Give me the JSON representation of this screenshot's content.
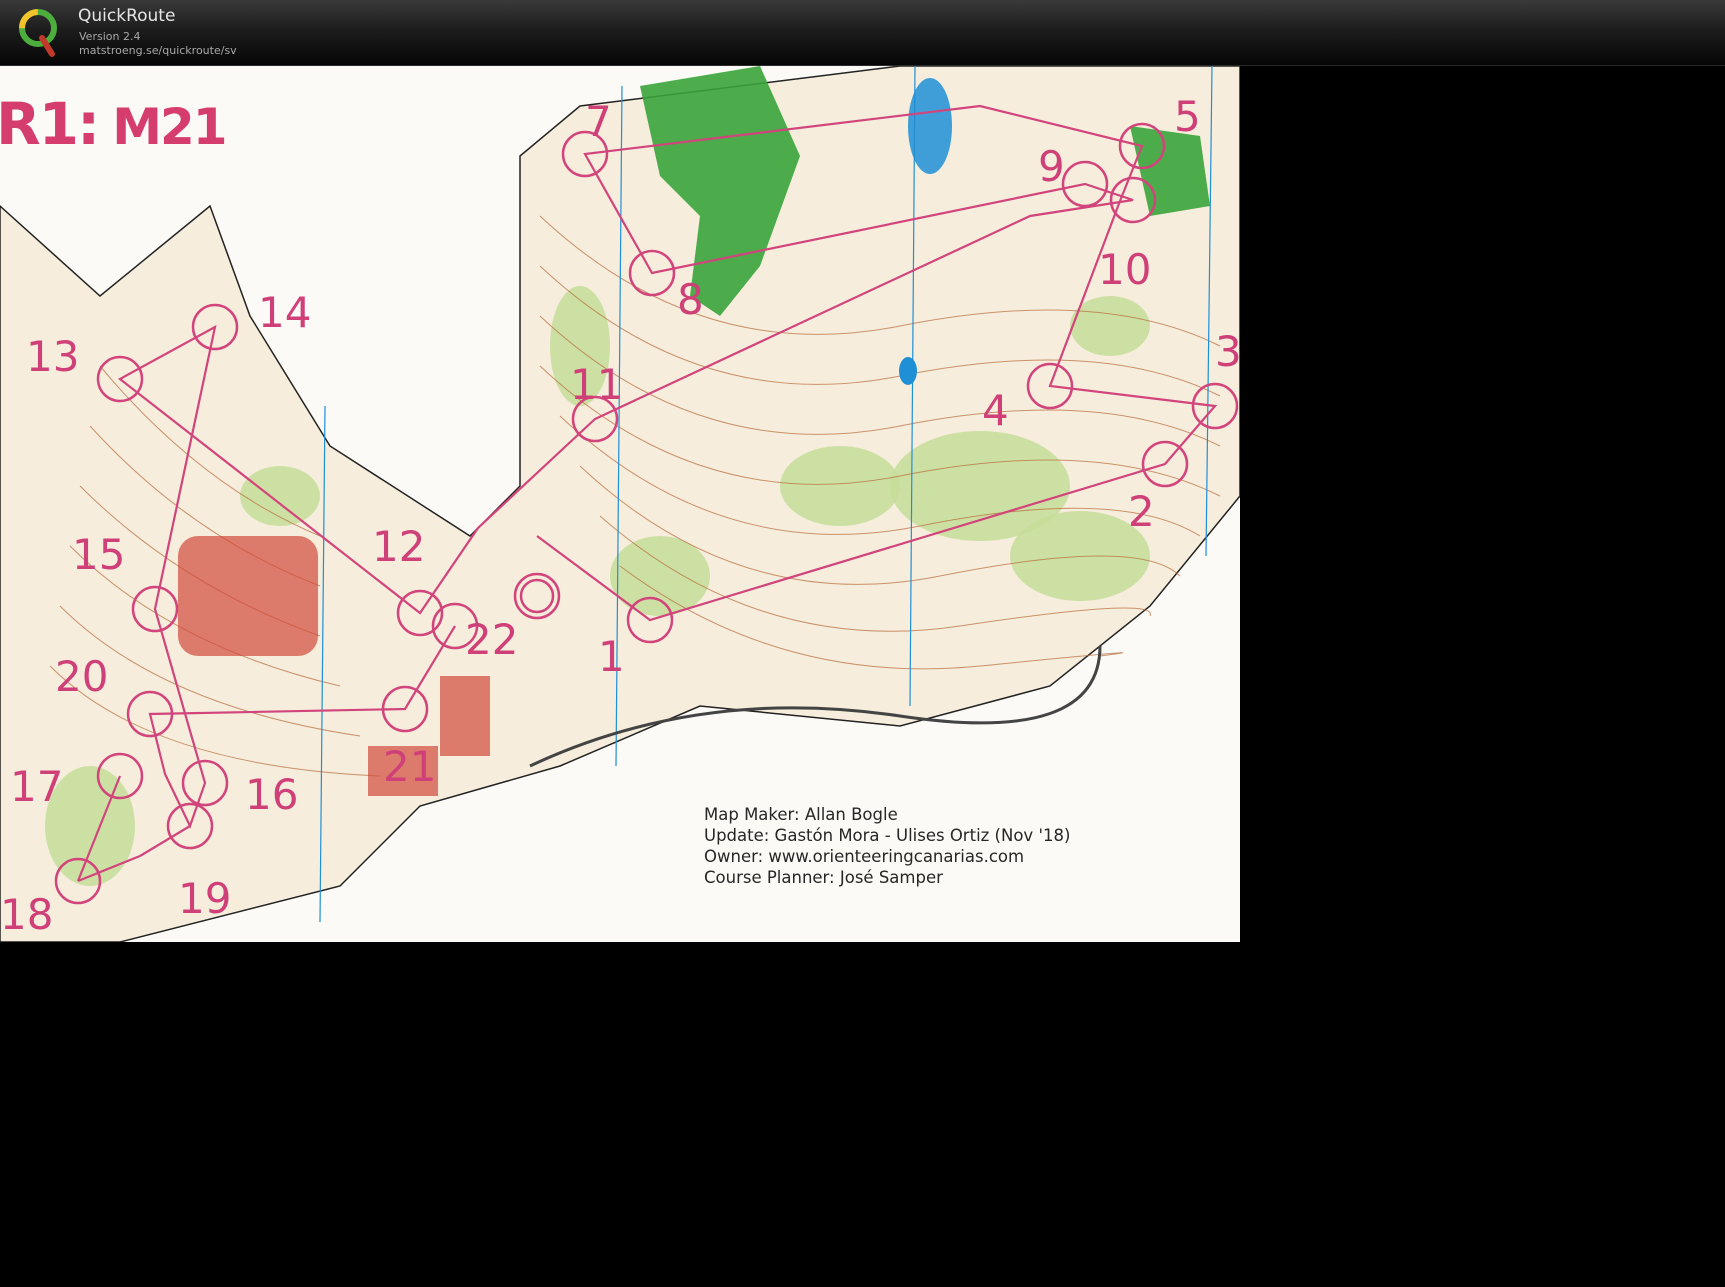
{
  "app": {
    "name": "QuickRoute",
    "version": "Version 2.4",
    "url": "matstroeng.se/quickroute/sv",
    "logo_letter": "Q"
  },
  "map": {
    "title_prefix": "R1:",
    "title_course": "M21",
    "credits": {
      "maker": "Map Maker: Allan Bogle",
      "update": "Update: Gastón Mora - Ulises Ortiz (Nov '18)",
      "owner": "Owner: www.orienteeringcanarias.com",
      "planner": "Course Planner: José Samper"
    },
    "controls": [
      "1",
      "2",
      "3",
      "4",
      "5",
      "7",
      "8",
      "9",
      "10",
      "11",
      "12",
      "13",
      "14",
      "15",
      "16",
      "17",
      "18",
      "19",
      "20",
      "21",
      "22"
    ],
    "colors": {
      "course": "#d2447c",
      "forest_green": "#3aa33a",
      "light_green": "#c6dd9a",
      "contour": "#b86a3a",
      "water": "#1f8fd6",
      "building": "#d24a3a"
    }
  }
}
